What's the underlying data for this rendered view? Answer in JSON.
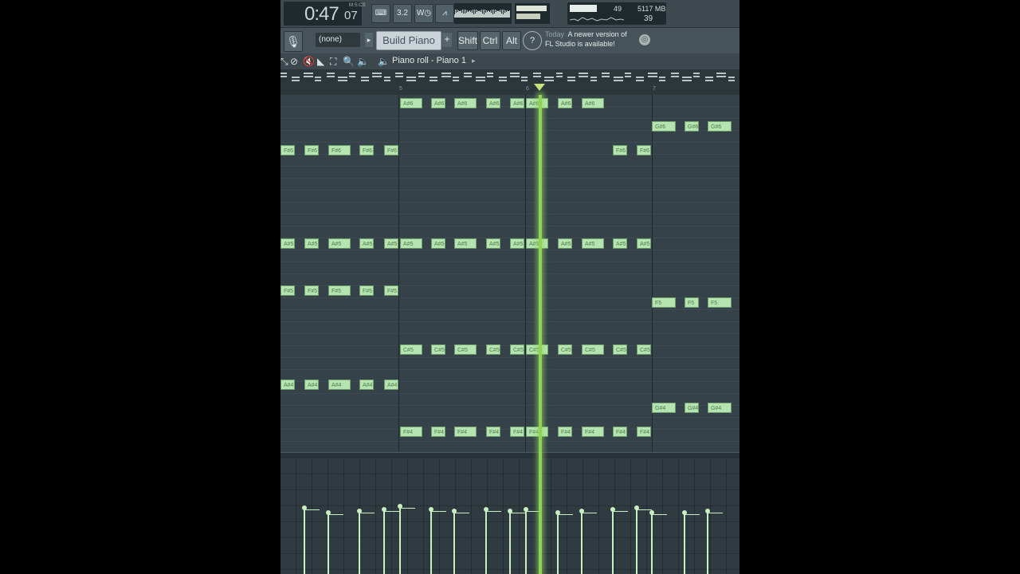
{
  "transport": {
    "time_main": "0:47",
    "time_sub": "07",
    "time_unit": "M:S:CS",
    "cpu_value": "49",
    "memory": "5117 MB",
    "polyphony": "39",
    "buttons": [
      {
        "name": "typing-keyboard-button",
        "label": "⌨"
      },
      {
        "name": "step-edit-button",
        "label": "3.2"
      },
      {
        "name": "wait-record-button",
        "label": "W◷"
      },
      {
        "name": "metronome-button",
        "label": "⩘"
      }
    ]
  },
  "toolbar2": {
    "mic_icon": "microphone-icon",
    "pattern": "(none)",
    "tool_name": "Build Piano",
    "modifiers": [
      "Shift",
      "Ctrl",
      "Alt"
    ],
    "news_today": "Today",
    "news_text_1": "A newer version of",
    "news_text_2": "FL Studio is available!"
  },
  "piano_roll": {
    "title": "Piano roll - Piano 1",
    "ruler_marks": [
      "5",
      "6",
      "7"
    ]
  },
  "notes": [
    {
      "label": "A#6",
      "row": 0,
      "start": 150,
      "len": 28
    },
    {
      "label": "A#6",
      "row": 0,
      "start": 189,
      "len": 18
    },
    {
      "label": "A#6",
      "row": 0,
      "start": 218,
      "len": 28
    },
    {
      "label": "A#6",
      "row": 0,
      "start": 258,
      "len": 18
    },
    {
      "label": "A#6",
      "row": 0,
      "start": 288,
      "len": 18
    },
    {
      "label": "A#6",
      "row": 0,
      "start": 308,
      "len": 28
    },
    {
      "label": "A#6",
      "row": 0,
      "start": 348,
      "len": 18
    },
    {
      "label": "A#6",
      "row": 0,
      "start": 378,
      "len": 28
    },
    {
      "label": "G#6",
      "row": 2,
      "start": 466,
      "len": 30
    },
    {
      "label": "G#6",
      "row": 2,
      "start": 507,
      "len": 18
    },
    {
      "label": "G#6",
      "row": 2,
      "start": 536,
      "len": 30
    },
    {
      "label": "F#6",
      "row": 4,
      "start": 0,
      "len": 18
    },
    {
      "label": "F#6",
      "row": 4,
      "start": 30,
      "len": 18
    },
    {
      "label": "F#6",
      "row": 4,
      "start": 60,
      "len": 28
    },
    {
      "label": "F#6",
      "row": 4,
      "start": 99,
      "len": 18
    },
    {
      "label": "F#6",
      "row": 4,
      "start": 130,
      "len": 18
    },
    {
      "label": "F#6",
      "row": 4,
      "start": 417,
      "len": 18
    },
    {
      "label": "F#6",
      "row": 4,
      "start": 447,
      "len": 18
    },
    {
      "label": "A#5",
      "row": 12,
      "start": 0,
      "len": 18
    },
    {
      "label": "A#5",
      "row": 12,
      "start": 30,
      "len": 18
    },
    {
      "label": "A#5",
      "row": 12,
      "start": 60,
      "len": 28
    },
    {
      "label": "A#5",
      "row": 12,
      "start": 99,
      "len": 18
    },
    {
      "label": "A#5",
      "row": 12,
      "start": 130,
      "len": 18
    },
    {
      "label": "A#5",
      "row": 12,
      "start": 150,
      "len": 28
    },
    {
      "label": "A#5",
      "row": 12,
      "start": 189,
      "len": 18
    },
    {
      "label": "A#5",
      "row": 12,
      "start": 218,
      "len": 28
    },
    {
      "label": "A#5",
      "row": 12,
      "start": 258,
      "len": 18
    },
    {
      "label": "A#5",
      "row": 12,
      "start": 288,
      "len": 18
    },
    {
      "label": "A#5",
      "row": 12,
      "start": 308,
      "len": 28
    },
    {
      "label": "A#5",
      "row": 12,
      "start": 348,
      "len": 18
    },
    {
      "label": "A#5",
      "row": 12,
      "start": 378,
      "len": 28
    },
    {
      "label": "A#5",
      "row": 12,
      "start": 417,
      "len": 18
    },
    {
      "label": "A#5",
      "row": 12,
      "start": 447,
      "len": 18
    },
    {
      "label": "F#5",
      "row": 16,
      "start": 0,
      "len": 18
    },
    {
      "label": "F#5",
      "row": 16,
      "start": 30,
      "len": 18
    },
    {
      "label": "F#5",
      "row": 16,
      "start": 60,
      "len": 28
    },
    {
      "label": "F#5",
      "row": 16,
      "start": 99,
      "len": 18
    },
    {
      "label": "F#5",
      "row": 16,
      "start": 130,
      "len": 18
    },
    {
      "label": "F5",
      "row": 17,
      "start": 466,
      "len": 30
    },
    {
      "label": "F5",
      "row": 17,
      "start": 507,
      "len": 18
    },
    {
      "label": "F5",
      "row": 17,
      "start": 536,
      "len": 30
    },
    {
      "label": "C#5",
      "row": 21,
      "start": 150,
      "len": 28
    },
    {
      "label": "C#5",
      "row": 21,
      "start": 189,
      "len": 18
    },
    {
      "label": "C#5",
      "row": 21,
      "start": 218,
      "len": 28
    },
    {
      "label": "C#5",
      "row": 21,
      "start": 258,
      "len": 18
    },
    {
      "label": "C#5",
      "row": 21,
      "start": 288,
      "len": 18
    },
    {
      "label": "C#5",
      "row": 21,
      "start": 308,
      "len": 28
    },
    {
      "label": "C#5",
      "row": 21,
      "start": 348,
      "len": 18
    },
    {
      "label": "C#5",
      "row": 21,
      "start": 378,
      "len": 28
    },
    {
      "label": "C#5",
      "row": 21,
      "start": 417,
      "len": 18
    },
    {
      "label": "C#5",
      "row": 21,
      "start": 447,
      "len": 18
    },
    {
      "label": "A#4",
      "row": 24,
      "start": 0,
      "len": 18
    },
    {
      "label": "A#4",
      "row": 24,
      "start": 30,
      "len": 18
    },
    {
      "label": "A#4",
      "row": 24,
      "start": 60,
      "len": 28
    },
    {
      "label": "A#4",
      "row": 24,
      "start": 99,
      "len": 18
    },
    {
      "label": "A#4",
      "row": 24,
      "start": 130,
      "len": 18
    },
    {
      "label": "G#4",
      "row": 26,
      "start": 466,
      "len": 30
    },
    {
      "label": "G#4",
      "row": 26,
      "start": 507,
      "len": 18
    },
    {
      "label": "G#4",
      "row": 26,
      "start": 536,
      "len": 30
    },
    {
      "label": "F#4",
      "row": 28,
      "start": 150,
      "len": 28
    },
    {
      "label": "F#4",
      "row": 28,
      "start": 189,
      "len": 18
    },
    {
      "label": "F#4",
      "row": 28,
      "start": 218,
      "len": 28
    },
    {
      "label": "F#4",
      "row": 28,
      "start": 258,
      "len": 18
    },
    {
      "label": "F#4",
      "row": 28,
      "start": 288,
      "len": 18
    },
    {
      "label": "F#4",
      "row": 28,
      "start": 308,
      "len": 28
    },
    {
      "label": "F#4",
      "row": 28,
      "start": 348,
      "len": 18
    },
    {
      "label": "F#4",
      "row": 28,
      "start": 378,
      "len": 28
    },
    {
      "label": "F#4",
      "row": 28,
      "start": 417,
      "len": 18
    },
    {
      "label": "F#4",
      "row": 28,
      "start": 447,
      "len": 18
    }
  ],
  "velocities": [
    {
      "pos": 29,
      "level": 0.92
    },
    {
      "pos": 59,
      "level": 0.86
    },
    {
      "pos": 98,
      "level": 0.88
    },
    {
      "pos": 129,
      "level": 0.9
    },
    {
      "pos": 149,
      "level": 0.94
    },
    {
      "pos": 188,
      "level": 0.9
    },
    {
      "pos": 217,
      "level": 0.88
    },
    {
      "pos": 257,
      "level": 0.9
    },
    {
      "pos": 287,
      "level": 0.88
    },
    {
      "pos": 307,
      "level": 0.9
    },
    {
      "pos": 347,
      "level": 0.86
    },
    {
      "pos": 377,
      "level": 0.88
    },
    {
      "pos": 416,
      "level": 0.9
    },
    {
      "pos": 446,
      "level": 0.92
    },
    {
      "pos": 465,
      "level": 0.86
    },
    {
      "pos": 506,
      "level": 0.86
    },
    {
      "pos": 535,
      "level": 0.88
    }
  ]
}
